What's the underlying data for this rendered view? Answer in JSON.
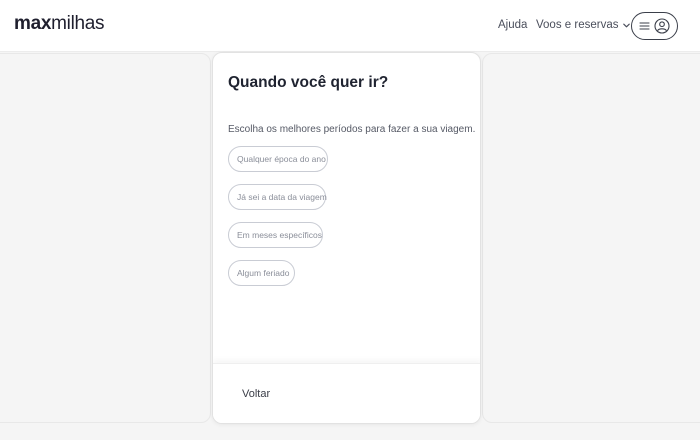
{
  "header": {
    "logo_bold": "max",
    "logo_light": "milhas",
    "help_label": "Ajuda",
    "trips_label": "Voos e reservas"
  },
  "card": {
    "title": "Quando você quer ir?",
    "subtitle": "Escolha os melhores períodos para fazer a sua viagem.",
    "options": [
      {
        "label": "Qualquer época do ano"
      },
      {
        "label": "Já sei a data da viagem"
      },
      {
        "label": "Em meses específicos"
      },
      {
        "label": "Algum feriado"
      }
    ],
    "back_label": "Voltar"
  },
  "icons": {
    "menu": "hamburger-icon",
    "user": "user-circle-icon",
    "dropdown": "chevron-down-icon"
  },
  "colors": {
    "text_dark": "#1f2330",
    "chip_border": "#c9ccd4",
    "chip_text": "#8a8e99",
    "background": "#f5f5f5"
  }
}
